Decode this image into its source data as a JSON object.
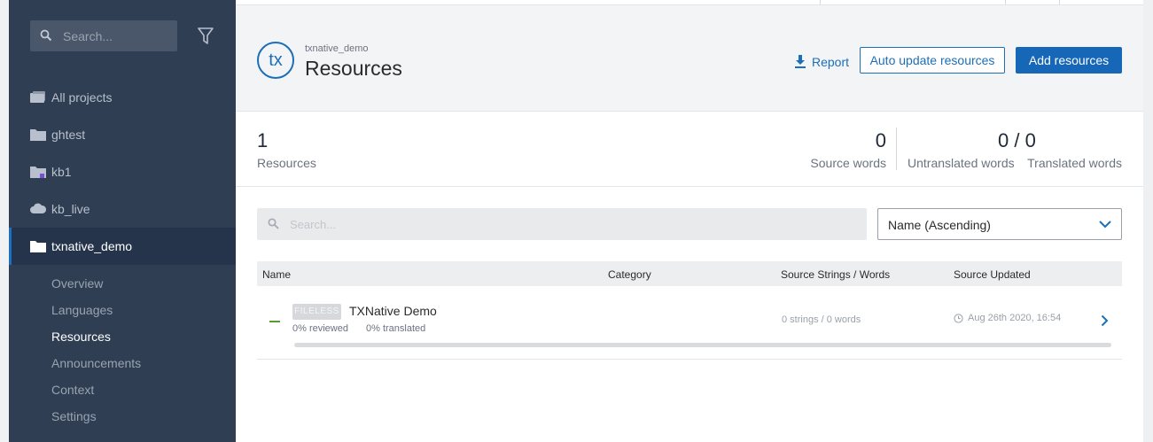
{
  "sidebar": {
    "search_placeholder": "Search...",
    "projects": [
      {
        "label": "All projects",
        "icon": "folders-icon"
      },
      {
        "label": "ghtest",
        "icon": "folder-icon"
      },
      {
        "label": "kb1",
        "icon": "folder-badge-icon"
      },
      {
        "label": "kb_live",
        "icon": "cloud-icon"
      },
      {
        "label": "txnative_demo",
        "icon": "folder-icon"
      }
    ],
    "active_project": "txnative_demo",
    "subnav": [
      "Overview",
      "Languages",
      "Resources",
      "Announcements",
      "Context",
      "Settings"
    ],
    "active_subnav": "Resources"
  },
  "header": {
    "logo_text": "tx",
    "project_name": "txnative_demo",
    "title": "Resources",
    "report_label": "Report",
    "auto_update_label": "Auto update resources",
    "add_label": "Add resources"
  },
  "stats": {
    "resources": {
      "value": "1",
      "label": "Resources"
    },
    "source_words": {
      "value": "0",
      "label": "Source words"
    },
    "untranslated_translated": {
      "value": "0 / 0"
    },
    "untranslated_label": "Untranslated words",
    "translated_label": "Translated words"
  },
  "filters": {
    "search_placeholder": "Search...",
    "sort_value": "Name (Ascending)"
  },
  "table": {
    "columns": [
      "Name",
      "Category",
      "Source Strings / Words",
      "Source Updated"
    ],
    "rows": [
      {
        "badge": "FILELESS",
        "name": "TXNative Demo",
        "reviewed": "0% reviewed",
        "translated": "0% translated",
        "category": "",
        "strings_words": "0 strings / 0 words",
        "updated": "Aug 26th 2020, 16:54",
        "progress": 0
      }
    ]
  },
  "colors": {
    "sidebar_bg": "#2f3e53",
    "accent": "#1b6fb8",
    "primary_button": "#1667b7",
    "status_green": "#5a9a2c"
  }
}
